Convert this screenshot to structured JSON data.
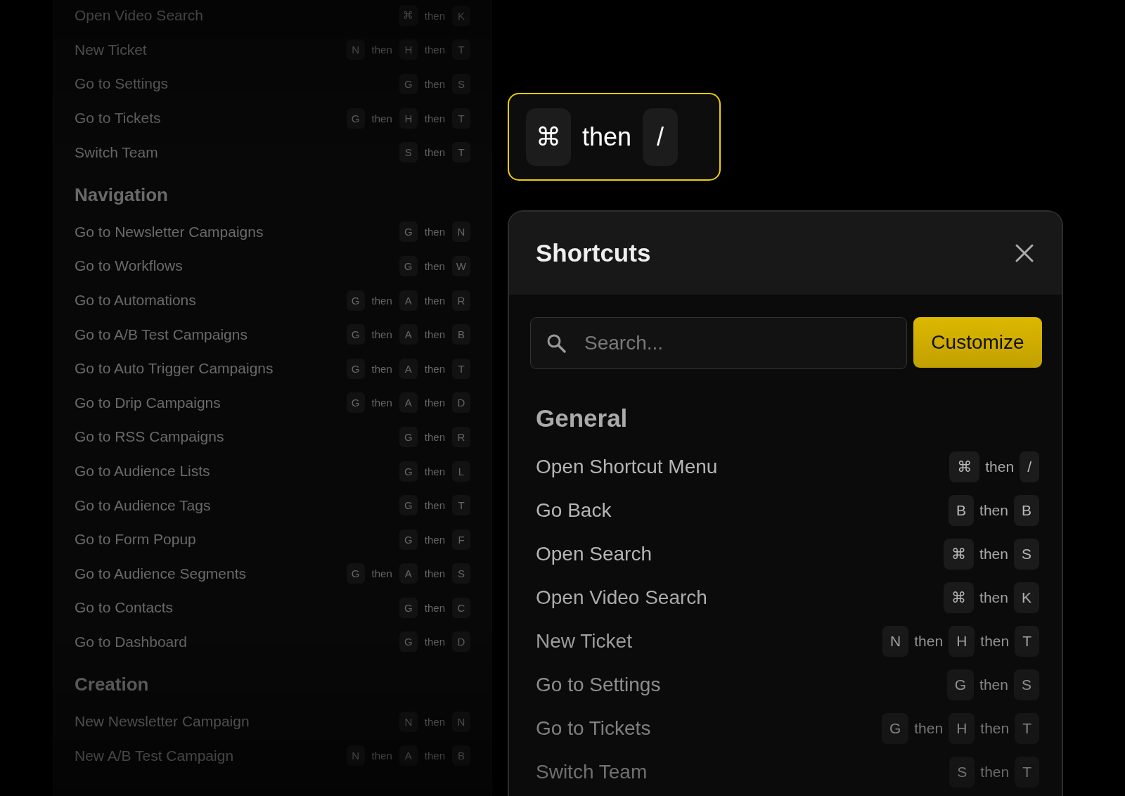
{
  "shortcut_list": {
    "sections": [
      {
        "rows": [
          {
            "label": "Open Video Search",
            "keys": [
              "⌘",
              "then",
              "K"
            ]
          },
          {
            "label": "New Ticket",
            "keys": [
              "N",
              "then",
              "H",
              "then",
              "T"
            ]
          },
          {
            "label": "Go to Settings",
            "keys": [
              "G",
              "then",
              "S"
            ]
          },
          {
            "label": "Go to Tickets",
            "keys": [
              "G",
              "then",
              "H",
              "then",
              "T"
            ]
          },
          {
            "label": "Switch Team",
            "keys": [
              "S",
              "then",
              "T"
            ]
          }
        ]
      },
      {
        "heading": "Navigation",
        "rows": [
          {
            "label": "Go to Newsletter Campaigns",
            "keys": [
              "G",
              "then",
              "N"
            ]
          },
          {
            "label": "Go to Workflows",
            "keys": [
              "G",
              "then",
              "W"
            ]
          },
          {
            "label": "Go to Automations",
            "keys": [
              "G",
              "then",
              "A",
              "then",
              "R"
            ]
          },
          {
            "label": "Go to A/B Test Campaigns",
            "keys": [
              "G",
              "then",
              "A",
              "then",
              "B"
            ]
          },
          {
            "label": "Go to Auto Trigger Campaigns",
            "keys": [
              "G",
              "then",
              "A",
              "then",
              "T"
            ]
          },
          {
            "label": "Go to Drip Campaigns",
            "keys": [
              "G",
              "then",
              "A",
              "then",
              "D"
            ]
          },
          {
            "label": "Go to RSS Campaigns",
            "keys": [
              "G",
              "then",
              "R"
            ]
          },
          {
            "label": "Go to Audience Lists",
            "keys": [
              "G",
              "then",
              "L"
            ]
          },
          {
            "label": "Go to Audience Tags",
            "keys": [
              "G",
              "then",
              "T"
            ]
          },
          {
            "label": "Go to Form Popup",
            "keys": [
              "G",
              "then",
              "F"
            ]
          },
          {
            "label": "Go to Audience Segments",
            "keys": [
              "G",
              "then",
              "A",
              "then",
              "S"
            ]
          },
          {
            "label": "Go to Contacts",
            "keys": [
              "G",
              "then",
              "C"
            ]
          },
          {
            "label": "Go to Dashboard",
            "keys": [
              "G",
              "then",
              "D"
            ]
          }
        ]
      },
      {
        "heading": "Creation",
        "rows": [
          {
            "label": "New Newsletter Campaign",
            "keys": [
              "N",
              "then",
              "N"
            ]
          },
          {
            "label": "New A/B Test Campaign",
            "keys": [
              "N",
              "then",
              "A",
              "then",
              "B"
            ]
          }
        ]
      }
    ]
  },
  "key_combo": [
    "⌘",
    "then",
    "/"
  ],
  "shortcuts_dialog": {
    "title": "Shortcuts",
    "search": {
      "placeholder": "Search..."
    },
    "customize_button": "Customize",
    "section": {
      "heading": "General",
      "rows": [
        {
          "label": "Open Shortcut Menu",
          "keys": [
            "⌘",
            "then",
            "/"
          ]
        },
        {
          "label": "Go Back",
          "keys": [
            "B",
            "then",
            "B"
          ]
        },
        {
          "label": "Open Search",
          "keys": [
            "⌘",
            "then",
            "S"
          ]
        },
        {
          "label": "Open Video Search",
          "keys": [
            "⌘",
            "then",
            "K"
          ]
        },
        {
          "label": "New Ticket",
          "keys": [
            "N",
            "then",
            "H",
            "then",
            "T"
          ]
        },
        {
          "label": "Go to Settings",
          "keys": [
            "G",
            "then",
            "S"
          ]
        },
        {
          "label": "Go to Tickets",
          "keys": [
            "G",
            "then",
            "H",
            "then",
            "T"
          ]
        },
        {
          "label": "Switch Team",
          "keys": [
            "S",
            "then",
            "T"
          ]
        }
      ]
    }
  }
}
